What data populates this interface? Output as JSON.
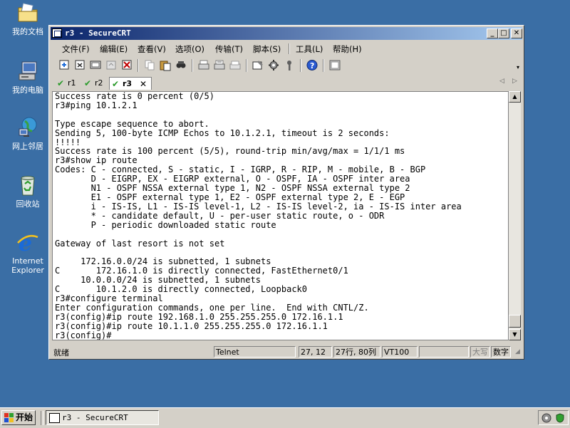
{
  "desktop": {
    "icons": [
      {
        "label": "我的文档",
        "icon": "my-documents-icon"
      },
      {
        "label": "我的电脑",
        "icon": "my-computer-icon"
      },
      {
        "label": "网上邻居",
        "icon": "network-places-icon"
      },
      {
        "label": "回收站",
        "icon": "recycle-bin-icon"
      },
      {
        "label": "Internet Explorer",
        "icon": "internet-explorer-icon"
      }
    ]
  },
  "window": {
    "title": "r3 - SecureCRT",
    "menu": [
      "文件(F)",
      "编辑(E)",
      "查看(V)",
      "选项(O)",
      "传输(T)",
      "脚本(S)",
      "工具(L)",
      "帮助(H)"
    ],
    "tabs": [
      {
        "label": "r1",
        "active": false
      },
      {
        "label": "r2",
        "active": false
      },
      {
        "label": "r3",
        "active": true
      }
    ],
    "terminal_lines": [
      "Success rate is 0 percent (0/5)",
      "r3#ping 10.1.2.1",
      "",
      "Type escape sequence to abort.",
      "Sending 5, 100-byte ICMP Echos to 10.1.2.1, timeout is 2 seconds:",
      "!!!!!",
      "Success rate is 100 percent (5/5), round-trip min/avg/max = 1/1/1 ms",
      "r3#show ip route",
      "Codes: C - connected, S - static, I - IGRP, R - RIP, M - mobile, B - BGP",
      "       D - EIGRP, EX - EIGRP external, O - OSPF, IA - OSPF inter area",
      "       N1 - OSPF NSSA external type 1, N2 - OSPF NSSA external type 2",
      "       E1 - OSPF external type 1, E2 - OSPF external type 2, E - EGP",
      "       i - IS-IS, L1 - IS-IS level-1, L2 - IS-IS level-2, ia - IS-IS inter area",
      "       * - candidate default, U - per-user static route, o - ODR",
      "       P - periodic downloaded static route",
      "",
      "Gateway of last resort is not set",
      "",
      "     172.16.0.0/24 is subnetted, 1 subnets",
      "C       172.16.1.0 is directly connected, FastEthernet0/1",
      "     10.0.0.0/24 is subnetted, 1 subnets",
      "C       10.1.2.0 is directly connected, Loopback0",
      "r3#configure terminal",
      "Enter configuration commands, one per line.  End with CNTL/Z.",
      "r3(config)#ip route 192.168.1.0 255.255.255.0 172.16.1.1",
      "r3(config)#ip route 10.1.1.0 255.255.255.0 172.16.1.1",
      "r3(config)#"
    ],
    "status": {
      "ready": "就绪",
      "protocol": "Telnet",
      "cursor": "27, 12",
      "size": "27行, 80列",
      "emulation": "VT100",
      "caps": "大写",
      "num": "数字"
    }
  },
  "taskbar": {
    "start_label": "开始",
    "task_label": "r3 - SecureCRT"
  }
}
